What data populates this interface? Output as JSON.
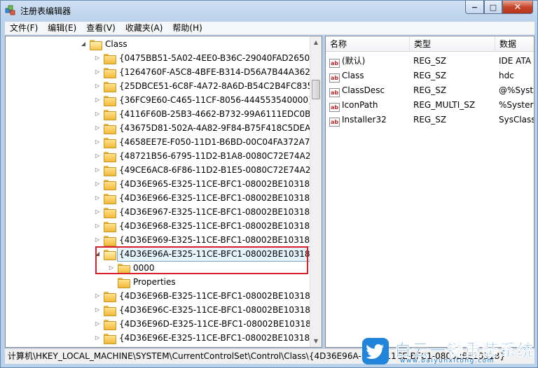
{
  "window": {
    "title": "注册表编辑器"
  },
  "menu": [
    "文件(F)",
    "编辑(E)",
    "查看(V)",
    "收藏夹(A)",
    "帮助(H)"
  ],
  "caption": {
    "minimize": "−",
    "maximize": "□",
    "close": "✕"
  },
  "tree": {
    "parent": "Class",
    "nodes": [
      "{0475BB51-5A02-4EE0-B36C-29040FAD2650}",
      "{1264760F-A5C8-4BFE-B314-D56A7B44A362}",
      "{25DBCE51-6C8F-4A72-8A6D-B54C2B4FC835}",
      "{36FC9E60-C465-11CF-8056-444553540000}",
      "{4116F60B-25B3-4662-B732-99A6111EDC0B}",
      "{43675D81-502A-4A82-9F84-B75F418C5DEA}",
      "{4658EE7E-F050-11D1-B6BD-00C04FA372A7}",
      "{48721B56-6795-11D2-B1A8-0080C72E74A2}",
      "{49CE6AC8-6F86-11D2-B1E5-0080C72E74A2}",
      "{4D36E965-E325-11CE-BFC1-08002BE10318}",
      "{4D36E966-E325-11CE-BFC1-08002BE10318}",
      "{4D36E967-E325-11CE-BFC1-08002BE10318}",
      "{4D36E968-E325-11CE-BFC1-08002BE10318}",
      "{4D36E969-E325-11CE-BFC1-08002BE10318}"
    ],
    "selected": "{4D36E96A-E325-11CE-BFC1-08002BE10318}",
    "children": [
      "0000",
      "Properties"
    ],
    "after": [
      "{4D36E96B-E325-11CE-BFC1-08002BE10318}",
      "{4D36E96C-E325-11CE-BFC1-08002BE10318}",
      "{4D36E96D-E325-11CE-BFC1-08002BE10318}",
      "{4D36E96E-E325-11CE-BFC1-08002BE10318}"
    ]
  },
  "list": {
    "columns": [
      "名称",
      "类型",
      "数据"
    ],
    "icon_text": "ab",
    "rows": [
      {
        "name": "(默认)",
        "type": "REG_SZ",
        "data": "IDE ATA"
      },
      {
        "name": "Class",
        "type": "REG_SZ",
        "data": "hdc"
      },
      {
        "name": "ClassDesc",
        "type": "REG_SZ",
        "data": "@%Syst"
      },
      {
        "name": "IconPath",
        "type": "REG_MULTI_SZ",
        "data": "%Syster"
      },
      {
        "name": "Installer32",
        "type": "REG_SZ",
        "data": "SysClass"
      }
    ]
  },
  "status": "计算机\\HKEY_LOCAL_MACHINE\\SYSTEM\\CurrentControlSet\\Control\\Class\\{4D36E96A-E325-11CE-BFC1-08002BE10318}",
  "watermark": {
    "title": "白云一键重装系统",
    "url": "www.baiyunxitong.com"
  },
  "colors": {
    "highlight": "#d8202c",
    "accent": "#1e7fd4"
  }
}
